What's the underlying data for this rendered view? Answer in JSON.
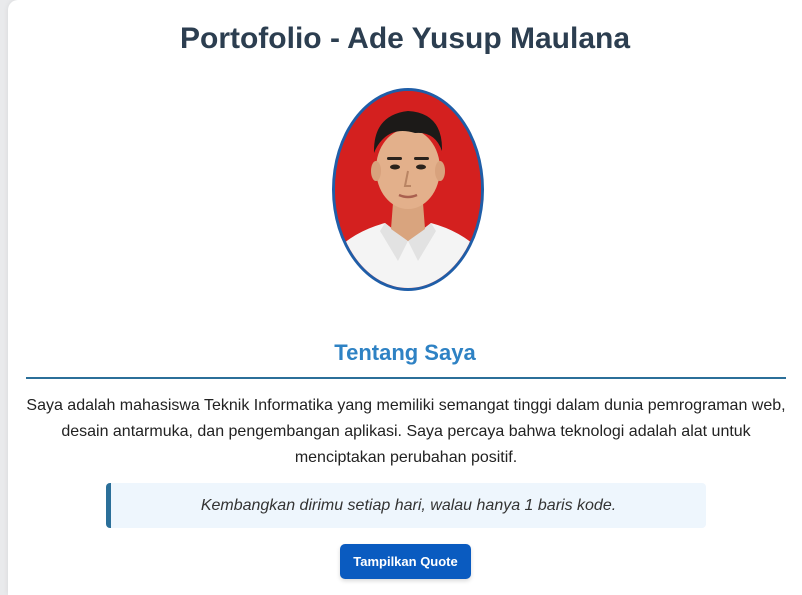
{
  "header": {
    "title": "Portofolio - Ade Yusup Maulana"
  },
  "profile": {
    "photo_subject": "profile-photo"
  },
  "about": {
    "heading": "Tentang Saya",
    "text": "Saya adalah mahasiswa Teknik Informatika yang memiliki semangat tinggi dalam dunia pemrograman web, desain antarmuka, dan pengembangan aplikasi. Saya percaya bahwa teknologi adalah alat untuk menciptakan perubahan positif."
  },
  "quote": {
    "text": "Kembangkan dirimu setiap hari, walau hanya 1 baris kode."
  },
  "actions": {
    "show_quote_label": "Tampilkan Quote"
  },
  "colors": {
    "title": "#2c3e50",
    "accent": "#2e82c4",
    "button": "#0a5bc0",
    "photo_background": "#d4201f"
  }
}
